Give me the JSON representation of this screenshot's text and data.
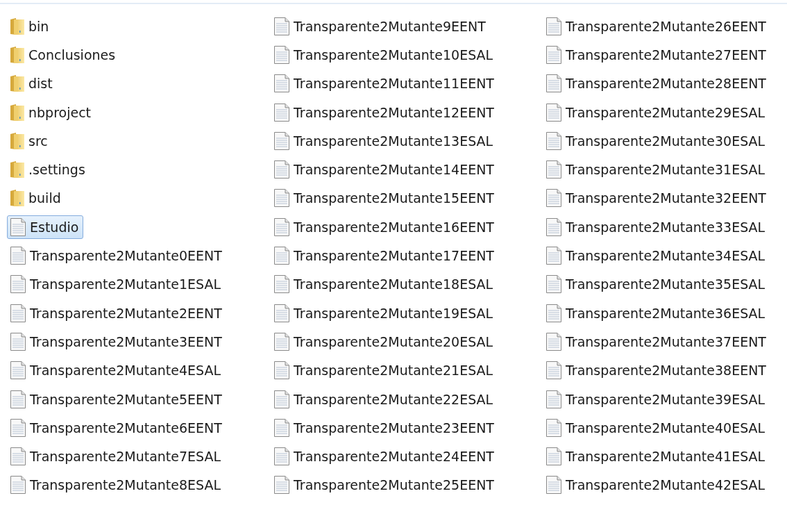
{
  "items": [
    {
      "name": "bin",
      "kind": "folder",
      "selected": false
    },
    {
      "name": "Conclusiones",
      "kind": "folder",
      "selected": false
    },
    {
      "name": "dist",
      "kind": "folder",
      "selected": false
    },
    {
      "name": "nbproject",
      "kind": "folder",
      "selected": false
    },
    {
      "name": "src",
      "kind": "folder",
      "selected": false
    },
    {
      "name": ".settings",
      "kind": "folder",
      "selected": false
    },
    {
      "name": "build",
      "kind": "folder",
      "selected": false
    },
    {
      "name": "Estudio",
      "kind": "file",
      "selected": true
    },
    {
      "name": "Transparente2Mutante0EENT",
      "kind": "file",
      "selected": false
    },
    {
      "name": "Transparente2Mutante1ESAL",
      "kind": "file",
      "selected": false
    },
    {
      "name": "Transparente2Mutante2EENT",
      "kind": "file",
      "selected": false
    },
    {
      "name": "Transparente2Mutante3EENT",
      "kind": "file",
      "selected": false
    },
    {
      "name": "Transparente2Mutante4ESAL",
      "kind": "file",
      "selected": false
    },
    {
      "name": "Transparente2Mutante5EENT",
      "kind": "file",
      "selected": false
    },
    {
      "name": "Transparente2Mutante6EENT",
      "kind": "file",
      "selected": false
    },
    {
      "name": "Transparente2Mutante7ESAL",
      "kind": "file",
      "selected": false
    },
    {
      "name": "Transparente2Mutante8ESAL",
      "kind": "file",
      "selected": false
    },
    {
      "name": "Transparente2Mutante9EENT",
      "kind": "file",
      "selected": false
    },
    {
      "name": "Transparente2Mutante10ESAL",
      "kind": "file",
      "selected": false
    },
    {
      "name": "Transparente2Mutante11EENT",
      "kind": "file",
      "selected": false
    },
    {
      "name": "Transparente2Mutante12EENT",
      "kind": "file",
      "selected": false
    },
    {
      "name": "Transparente2Mutante13ESAL",
      "kind": "file",
      "selected": false
    },
    {
      "name": "Transparente2Mutante14EENT",
      "kind": "file",
      "selected": false
    },
    {
      "name": "Transparente2Mutante15EENT",
      "kind": "file",
      "selected": false
    },
    {
      "name": "Transparente2Mutante16EENT",
      "kind": "file",
      "selected": false
    },
    {
      "name": "Transparente2Mutante17EENT",
      "kind": "file",
      "selected": false
    },
    {
      "name": "Transparente2Mutante18ESAL",
      "kind": "file",
      "selected": false
    },
    {
      "name": "Transparente2Mutante19ESAL",
      "kind": "file",
      "selected": false
    },
    {
      "name": "Transparente2Mutante20ESAL",
      "kind": "file",
      "selected": false
    },
    {
      "name": "Transparente2Mutante21ESAL",
      "kind": "file",
      "selected": false
    },
    {
      "name": "Transparente2Mutante22ESAL",
      "kind": "file",
      "selected": false
    },
    {
      "name": "Transparente2Mutante23EENT",
      "kind": "file",
      "selected": false
    },
    {
      "name": "Transparente2Mutante24EENT",
      "kind": "file",
      "selected": false
    },
    {
      "name": "Transparente2Mutante25EENT",
      "kind": "file",
      "selected": false
    },
    {
      "name": "Transparente2Mutante26EENT",
      "kind": "file",
      "selected": false
    },
    {
      "name": "Transparente2Mutante27EENT",
      "kind": "file",
      "selected": false
    },
    {
      "name": "Transparente2Mutante28EENT",
      "kind": "file",
      "selected": false
    },
    {
      "name": "Transparente2Mutante29ESAL",
      "kind": "file",
      "selected": false
    },
    {
      "name": "Transparente2Mutante30ESAL",
      "kind": "file",
      "selected": false
    },
    {
      "name": "Transparente2Mutante31ESAL",
      "kind": "file",
      "selected": false
    },
    {
      "name": "Transparente2Mutante32EENT",
      "kind": "file",
      "selected": false
    },
    {
      "name": "Transparente2Mutante33ESAL",
      "kind": "file",
      "selected": false
    },
    {
      "name": "Transparente2Mutante34ESAL",
      "kind": "file",
      "selected": false
    },
    {
      "name": "Transparente2Mutante35ESAL",
      "kind": "file",
      "selected": false
    },
    {
      "name": "Transparente2Mutante36ESAL",
      "kind": "file",
      "selected": false
    },
    {
      "name": "Transparente2Mutante37EENT",
      "kind": "file",
      "selected": false
    },
    {
      "name": "Transparente2Mutante38EENT",
      "kind": "file",
      "selected": false
    },
    {
      "name": "Transparente2Mutante39ESAL",
      "kind": "file",
      "selected": false
    },
    {
      "name": "Transparente2Mutante40ESAL",
      "kind": "file",
      "selected": false
    },
    {
      "name": "Transparente2Mutante41ESAL",
      "kind": "file",
      "selected": false
    },
    {
      "name": "Transparente2Mutante42ESAL",
      "kind": "file",
      "selected": false
    }
  ]
}
